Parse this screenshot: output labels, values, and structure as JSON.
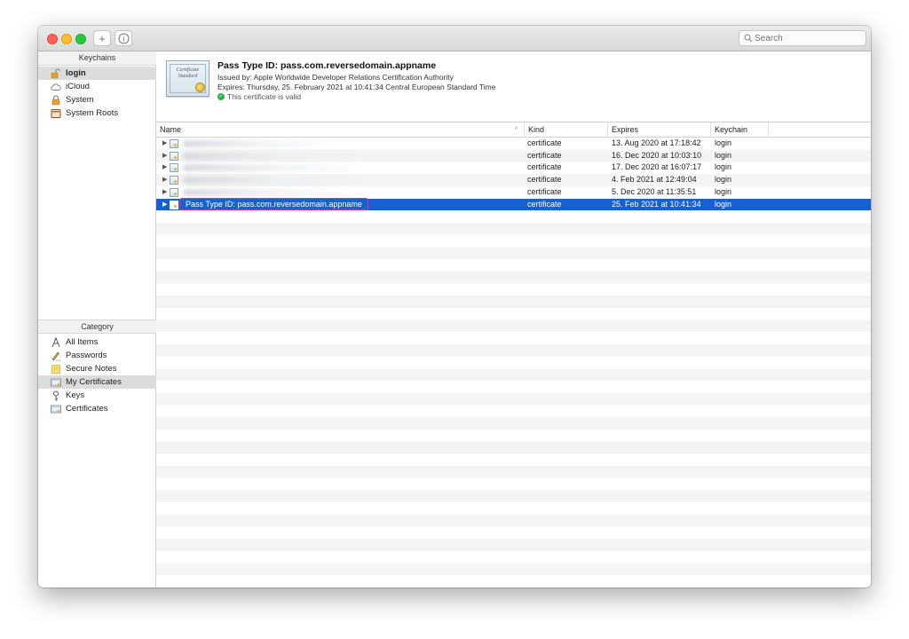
{
  "toolbar": {
    "add_label": "+",
    "info_label": "i",
    "search_placeholder": "Search"
  },
  "sidebar": {
    "keychains_header": "Keychains",
    "keychains": [
      {
        "label": "login",
        "icon": "lock-open-icon",
        "selected": true
      },
      {
        "label": "iCloud",
        "icon": "cloud-icon"
      },
      {
        "label": "System",
        "icon": "lock-icon"
      },
      {
        "label": "System Roots",
        "icon": "cabinet-icon"
      }
    ],
    "category_header": "Category",
    "categories": [
      {
        "label": "All Items",
        "icon": "all-items-icon"
      },
      {
        "label": "Passwords",
        "icon": "pen-icon"
      },
      {
        "label": "Secure Notes",
        "icon": "note-icon"
      },
      {
        "label": "My Certificates",
        "icon": "certificate-icon",
        "selected": true
      },
      {
        "label": "Keys",
        "icon": "key-icon"
      },
      {
        "label": "Certificates",
        "icon": "certificate-icon"
      }
    ]
  },
  "detail": {
    "thumb_line1": "Certificate",
    "thumb_line2": "Standard",
    "title": "Pass Type ID: pass.com.reversedomain.appname",
    "issued_by": "Issued by: Apple Worldwide Developer Relations Certification Authority",
    "expires": "Expires: Thursday, 25. February 2021 at 10:41:34 Central European Standard Time",
    "status": "This certificate is valid"
  },
  "table": {
    "columns": {
      "name": "Name",
      "kind": "Kind",
      "expires": "Expires",
      "keychain": "Keychain"
    },
    "rows": [
      {
        "name": "",
        "kind": "certificate",
        "expires": "13. Aug 2020 at 17:18:42",
        "keychain": "login"
      },
      {
        "name": "",
        "kind": "certificate",
        "expires": "16. Dec 2020 at 10:03:10",
        "keychain": "login"
      },
      {
        "name": "",
        "kind": "certificate",
        "expires": "17. Dec 2020 at 16:07:17",
        "keychain": "login"
      },
      {
        "name": "",
        "kind": "certificate",
        "expires": "4. Feb 2021 at 12:49:04",
        "keychain": "login"
      },
      {
        "name": "",
        "kind": "certificate",
        "expires": "5. Dec 2020 at 11:35:51",
        "keychain": "login"
      },
      {
        "name": "Pass Type ID: pass.com.reversedomain.appname",
        "kind": "certificate",
        "expires": "25. Feb 2021 at 10:41:34",
        "keychain": "login",
        "selected": true
      }
    ]
  },
  "colors": {
    "selection": "#1560d4",
    "highlight_border": "#e8337a",
    "valid": "#2db34a"
  }
}
